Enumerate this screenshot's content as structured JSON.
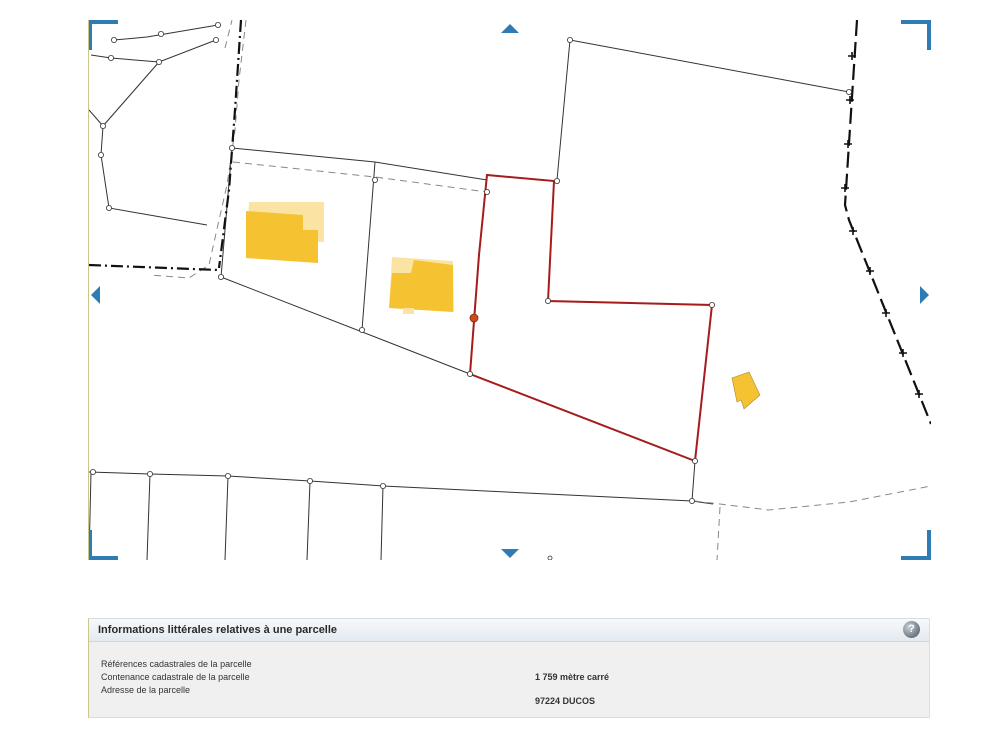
{
  "map": {
    "parcel_outline_color": "#a61c1c",
    "building_color": "#f5c232",
    "building_light_color": "#fbe3a3",
    "control_color": "#2f7bb3",
    "controls": [
      "pan-up-arrow",
      "pan-down-arrow",
      "pan-left-arrow",
      "pan-right-arrow"
    ]
  },
  "panel": {
    "title": "Informations littérales relatives à une parcelle",
    "help_icon": "?",
    "rows": [
      {
        "label": "Références cadastrales de la parcelle",
        "value": ""
      },
      {
        "label": "Contenance cadastrale de la parcelle",
        "value": "1 759 mètre carré"
      },
      {
        "label": "Adresse de la parcelle",
        "value": "97224 DUCOS"
      }
    ]
  }
}
